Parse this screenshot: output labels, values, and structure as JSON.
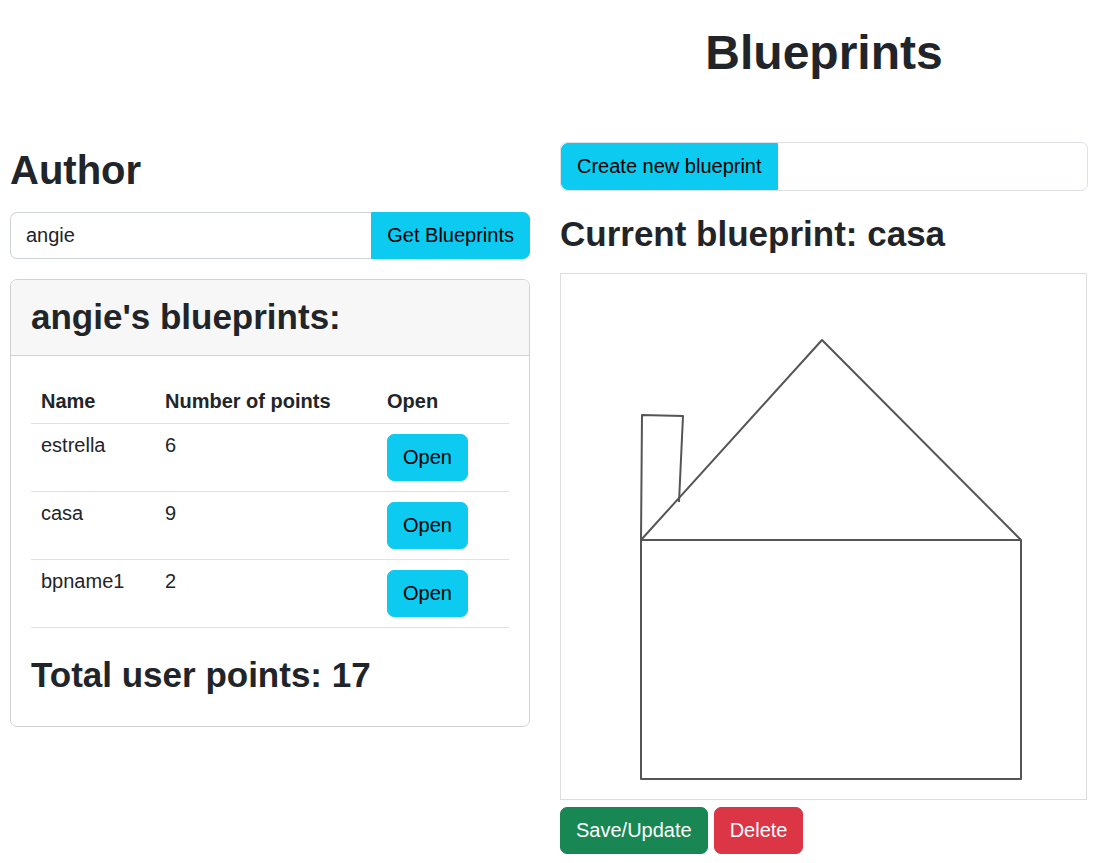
{
  "page": {
    "title": "Blueprints"
  },
  "author": {
    "label": "Author",
    "input_value": "angie",
    "button": "Get Blueprints"
  },
  "blueprints_card": {
    "title": "angie's blueprints:",
    "columns": [
      "Name",
      "Number of points",
      "Open"
    ],
    "rows": [
      {
        "name": "estrella",
        "points": "6",
        "button": "Open"
      },
      {
        "name": "casa",
        "points": "9",
        "button": "Open"
      },
      {
        "name": "bpname1",
        "points": "2",
        "button": "Open"
      }
    ],
    "total": "Total user points: 17"
  },
  "editor": {
    "create_button": "Create new blueprint",
    "current": "Current blueprint: casa",
    "canvas": {
      "strokes": [
        [
          [
            80,
            266
          ],
          [
            261,
            66
          ],
          [
            460,
            266
          ],
          [
            80,
            266
          ],
          [
            80,
            505
          ],
          [
            460,
            505
          ],
          [
            460,
            266
          ]
        ],
        [
          [
            80,
            266
          ],
          [
            81,
            141
          ],
          [
            122,
            142
          ],
          [
            118,
            228
          ]
        ]
      ]
    },
    "buttons": [
      {
        "label": "Save/Update",
        "color": "#198754"
      },
      {
        "label": "Delete",
        "color": "#dc3545"
      }
    ]
  }
}
